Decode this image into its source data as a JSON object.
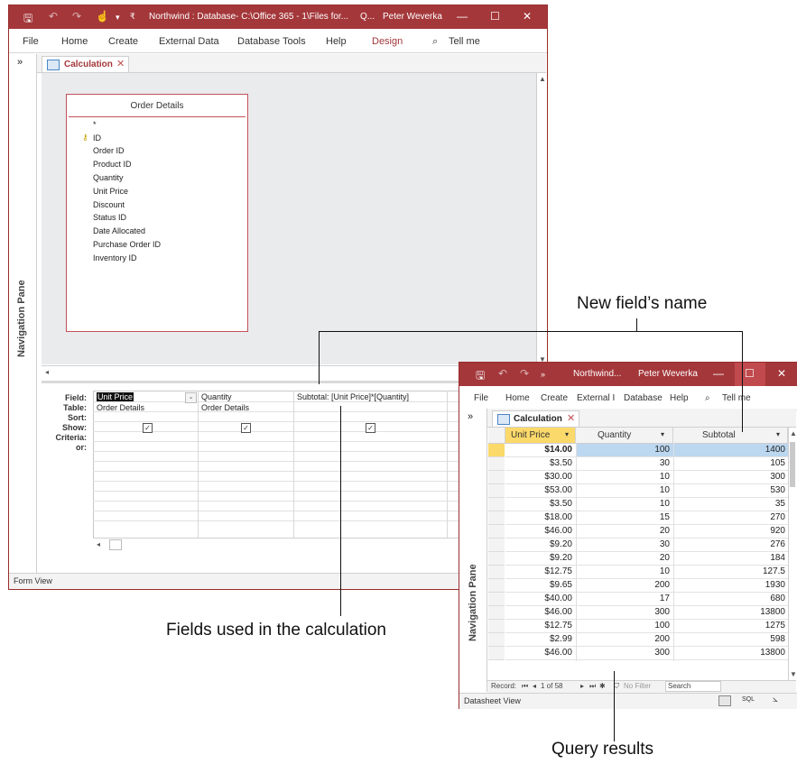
{
  "design_window": {
    "title": "Northwind : Database- C:\\Office 365 - 1\\Files for...",
    "search_hint": "Q...",
    "user": "Peter Weverka",
    "ribbon_tabs": [
      "File",
      "Home",
      "Create",
      "External Data",
      "Database Tools",
      "Help",
      "Design"
    ],
    "tell_me": "Tell me",
    "collapse_glyph": "»",
    "nav_pane_label": "Navigation Pane",
    "tab_label": "Calculation",
    "table_box": {
      "title": "Order Details",
      "fields": [
        "*",
        "ID",
        "Order ID",
        "Product ID",
        "Quantity",
        "Unit Price",
        "Discount",
        "Status ID",
        "Date Allocated",
        "Purchase Order ID",
        "Inventory ID"
      ]
    },
    "grid": {
      "row_labels": [
        "Field:",
        "Table:",
        "Sort:",
        "Show:",
        "Criteria:",
        "or:"
      ],
      "columns": [
        {
          "field": "Unit Price",
          "table": "Order Details",
          "show": true
        },
        {
          "field": "Quantity",
          "table": "Order Details",
          "show": true
        },
        {
          "field": "Subtotal: [Unit Price]*[Quantity]",
          "table": "",
          "show": true
        }
      ]
    },
    "status": "Form View"
  },
  "results_window": {
    "title": "Northwind...",
    "user": "Peter Weverka",
    "ribbon_tabs": [
      "File",
      "Home",
      "Create",
      "External I",
      "Database",
      "Help"
    ],
    "tell_me": "Tell me",
    "collapse_glyph": "»",
    "nav_pane_label": "Navigation Pane",
    "tab_label": "Calculation",
    "headers": [
      "Unit Price",
      "Quantity",
      "Subtotal"
    ],
    "rows": [
      [
        "$14.00",
        "100",
        "1400"
      ],
      [
        "$3.50",
        "30",
        "105"
      ],
      [
        "$30.00",
        "10",
        "300"
      ],
      [
        "$53.00",
        "10",
        "530"
      ],
      [
        "$3.50",
        "10",
        "35"
      ],
      [
        "$18.00",
        "15",
        "270"
      ],
      [
        "$46.00",
        "20",
        "920"
      ],
      [
        "$9.20",
        "30",
        "276"
      ],
      [
        "$9.20",
        "20",
        "184"
      ],
      [
        "$12.75",
        "10",
        "127.5"
      ],
      [
        "$9.65",
        "200",
        "1930"
      ],
      [
        "$40.00",
        "17",
        "680"
      ],
      [
        "$46.00",
        "300",
        "13800"
      ],
      [
        "$12.75",
        "100",
        "1275"
      ],
      [
        "$2.99",
        "200",
        "598"
      ],
      [
        "$46.00",
        "300",
        "13800"
      ]
    ],
    "record_nav": {
      "label": "Record:",
      "position": "1 of 58",
      "filter": "No Filter",
      "search": "Search"
    },
    "status": "Datasheet View",
    "view_sql": "SQL"
  },
  "callouts": {
    "new_field": "New field’s name",
    "fields_used": "Fields used in the calculation",
    "query_results": "Query results"
  },
  "colors": {
    "access_accent": "#a4373a",
    "selection": "#bcd7f0",
    "header_highlight": "#fbd96a"
  }
}
